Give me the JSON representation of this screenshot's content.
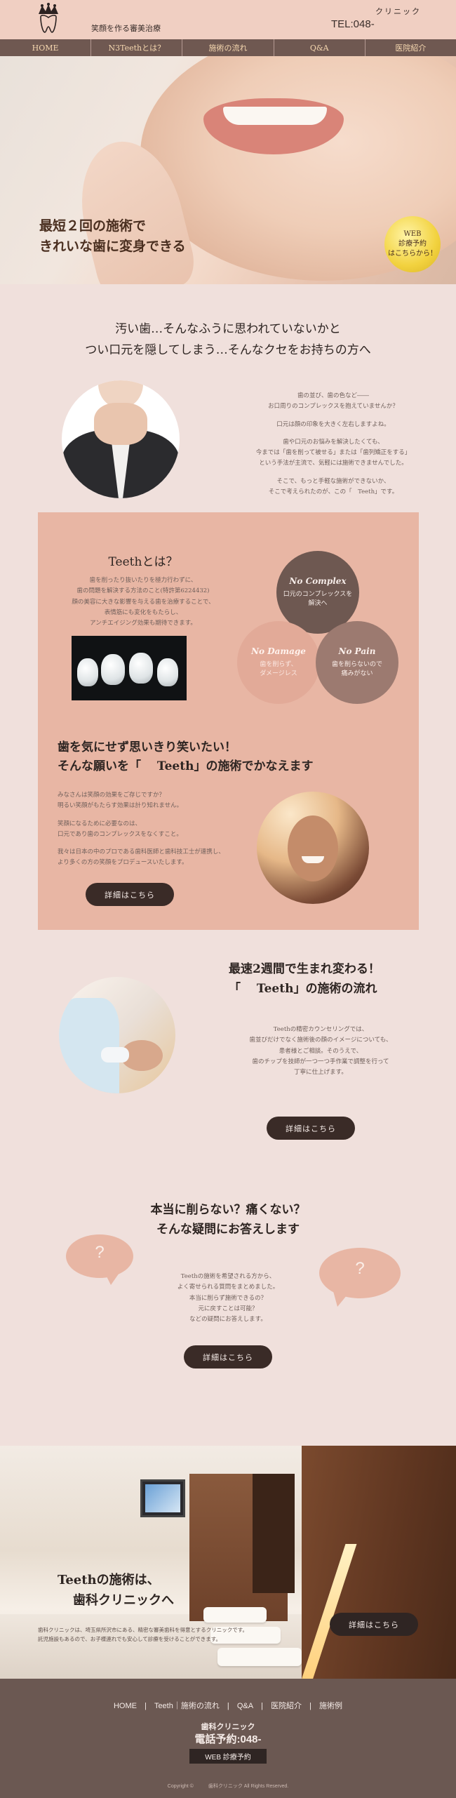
{
  "header": {
    "tagline": "笑顔を作る審美治療",
    "clinic_name": "クリニック",
    "tel": "TEL:048-"
  },
  "nav": {
    "items": [
      {
        "label": "HOME"
      },
      {
        "label": "N3Teethとは？"
      },
      {
        "label": "施術の流れ"
      },
      {
        "label": "Q&A"
      },
      {
        "label": "医院紹介"
      }
    ]
  },
  "hero": {
    "title_line1": "最短２回の施術で",
    "title_line2": "きれいな歯に変身できる",
    "badge_line1": "WEB",
    "badge_line2": "診療予約",
    "badge_line3": "はこちらから！"
  },
  "intro": {
    "heading_line1": "汚い歯…そんなふうに思われていないかと",
    "heading_line2": "つい口元を隠してしまう…そんなクセをお持ちの方へ",
    "paragraphs": [
      "歯の並び、歯の色など――\nお口周りのコンプレックスを抱えていませんか？",
      "口元は顔の印象を大きく左右しますよね。",
      "歯や口元のお悩みを解決したくても、\n今までは「歯を削って被せる」または「歯列矯正をする」\nという手法が主流で、気軽には施術できませんでした。",
      "そこで、もっと手軽な施術ができないか、\nそこで考えられたのが、この「　Teeth」です。"
    ]
  },
  "about": {
    "title": "Teethとは？",
    "desc": "歯を削ったり抜いたりを極力行わずに、\n歯の問題を解決する方法のこと(特許第6224432)\n顔の美容に大きな影響を与える歯を治療することで、\n表情筋にも変化をもたらし、\nアンチエイジング効果も期待できます。",
    "bubbles": [
      {
        "title": "No Complex",
        "text": "口元のコンプレックスを\n解決へ"
      },
      {
        "title": "No Damage",
        "text": "歯を削らず、\nダメージレス"
      },
      {
        "title": "No Pain",
        "text": "歯を削らないので\n痛みがない"
      }
    ],
    "smile_title_line1": "歯を気にせず思いきり笑いたい！",
    "smile_title_line2": "そんな願いを「　 Teeth」の施術でかなえます",
    "smile_paragraphs": [
      "みなさんは笑顔の効果をご存じですか？\n明るい笑顔がもたらす効果は計り知れません。",
      "笑顔になるために必要なのは、\n口元であり歯のコンプレックスをなくすこと。",
      "我々は日本の中のプロである歯科医師と歯科技工士が連携し、\nより多くの方の笑顔をプロデュースいたします。"
    ],
    "button_label": "詳細はこちら"
  },
  "flow": {
    "title_line1": "最速2週間で生まれ変わる！",
    "title_line2": "「　  Teeth」の施術の流れ",
    "text": "Teethの精密カウンセリングでは、\n歯並びだけでなく施術後の顔のイメージについても、\n患者様とご相談。そのうえで、\n歯のチップを技師が一つ一つ手作業で調整を行って\n丁寧に仕上げます。",
    "button_label": "詳細はこちら"
  },
  "qa": {
    "title_line1": "本当に削らない？痛くない？",
    "title_line2": "そんな疑問にお答えします",
    "question_mark": "?",
    "text": "Teethの施術を希望される方から、\nよく寄せられる質問をまとめました。\n本当に削らず施術できるの？\n元に戻すことは可能？\nなどの疑問にお答えします。",
    "button_label": "詳細はこちら"
  },
  "clinic": {
    "title_line1": "Teethの施術は、",
    "title_line2": "歯科クリニックへ",
    "text": "歯科クリニックは、埼玉県所沢市にある、精密な審美歯科を得意とするクリニックです。\n託児施設もあるので、お子様連れでも安心して診療を受けることができます。",
    "button_label": "詳細はこちら"
  },
  "footer": {
    "nav": [
      "HOME",
      "Teeth｜施術の流れ",
      "Q&A",
      "医院紹介",
      "施術例"
    ],
    "separator": "|",
    "clinic_name": "歯科クリニック",
    "tel": "電話予約:048-",
    "web_button": "WEB 診療予約",
    "copyright": "Copyright ©　　　歯科クリニック All Rights Reserved."
  },
  "colors": {
    "header_bg": "#f0cfc2",
    "nav_bg": "#6f5851",
    "nav_text": "#f6d8b0",
    "page_bg": "#f0e0dc",
    "pink_panel": "#e8b6a4",
    "button_bg": "#3a2b27",
    "footer_bg": "#6b5852",
    "badge": "#f2d23f"
  }
}
